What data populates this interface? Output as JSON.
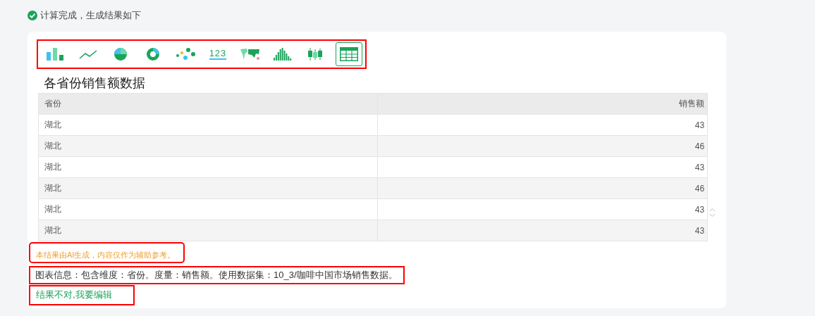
{
  "status": {
    "text": "计算完成，生成结果如下"
  },
  "chart_types": {
    "highlighted": true,
    "items": [
      {
        "kind": "bar",
        "selected": false
      },
      {
        "kind": "line",
        "selected": false
      },
      {
        "kind": "pie",
        "selected": false
      },
      {
        "kind": "donut",
        "selected": false
      },
      {
        "kind": "scatter",
        "selected": false
      },
      {
        "kind": "number",
        "label": "123",
        "selected": false
      },
      {
        "kind": "map",
        "selected": false
      },
      {
        "kind": "histogram",
        "selected": false
      },
      {
        "kind": "boxplot",
        "selected": false
      },
      {
        "kind": "table",
        "selected": true
      }
    ]
  },
  "table": {
    "title": "各省份销售额数据",
    "columns": [
      "省份",
      "销售额"
    ],
    "rows": [
      [
        "湖北",
        "43"
      ],
      [
        "湖北",
        "46"
      ],
      [
        "湖北",
        "43"
      ],
      [
        "湖北",
        "46"
      ],
      [
        "湖北",
        "43"
      ],
      [
        "湖北",
        "43"
      ]
    ]
  },
  "notice": {
    "text": "本结果由AI生成，内容仅作为辅助参考。",
    "highlighted": true
  },
  "info": {
    "text": "图表信息：包含维度：省份。度量：销售额。使用数据集：10_3/咖啡中国市场销售数据。",
    "highlighted": true
  },
  "edit_link": {
    "text": "结果不对,我要编辑",
    "highlighted": true
  }
}
